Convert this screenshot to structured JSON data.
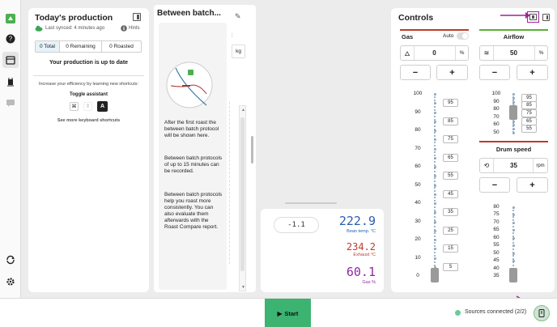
{
  "production": {
    "title": "Today's production",
    "last_synced": "Last synced: 4 minutes ago",
    "hints": "Hints",
    "tabs": [
      "0 Total",
      "0 Remaining",
      "0 Roasted"
    ],
    "status": "Your production is up to date",
    "efficiency_text": "Increase your efficiency by learning new shortcuts:",
    "toggle_label": "Toggle assistant",
    "keys": [
      "⌘",
      "⇧",
      "A"
    ],
    "see_more": "See more keyboard shortcuts"
  },
  "between_batch": {
    "title": "Between batch...",
    "p1": "After the first roast the between batch protocol will be shown here.",
    "p2": "Between batch protocols of up to 15 minutes can be recorded.",
    "p3": "Between batch protocols help you roast more consistently. You can also evaluate them afterwards with the Roast Compare report."
  },
  "unit_label": "kg",
  "readings": {
    "delta": "-1.1",
    "bean_temp": "222.9",
    "bean_label": "Bean temp. °C",
    "exhaust": "234.2",
    "exhaust_label": "Exhaust °C",
    "gas": "60.1",
    "gas_label": "Gas %",
    "bean_color": "#2a5db0",
    "exhaust_color": "#c0392b",
    "gas_color": "#8e2a9e"
  },
  "controls": {
    "title": "Controls",
    "gas": {
      "label": "Gas",
      "auto_label": "Auto",
      "value": "0",
      "unit": "%",
      "ticks_left": [
        "100",
        "90",
        "80",
        "70",
        "60",
        "50",
        "40",
        "30",
        "20",
        "10",
        "0"
      ],
      "ticks_right": [
        "95",
        "85",
        "75",
        "65",
        "55",
        "45",
        "35",
        "25",
        "15",
        "5"
      ],
      "level": 0.0,
      "color": "#c0392b"
    },
    "airflow": {
      "label": "Airflow",
      "value": "50",
      "unit": "%",
      "ticks_left": [
        "100",
        "90",
        "80",
        "70",
        "60",
        "50"
      ],
      "ticks_right": [
        "95",
        "85",
        "75",
        "65",
        "55"
      ],
      "level": 0.5,
      "color": "#5ab033"
    },
    "drum": {
      "label": "Drum speed",
      "value": "35",
      "unit": "rpm",
      "ticks_left": [
        "80",
        "75",
        "70",
        "65",
        "60",
        "55",
        "50",
        "45",
        "40",
        "35"
      ],
      "level": 0.0,
      "color": "#c0392b"
    },
    "minus": "−",
    "plus": "+"
  },
  "footer": {
    "start": "Start",
    "sources": "Sources connected (2/2)",
    "start_color": "#3cb371",
    "sources_color": "#66cc99"
  },
  "annotation_color": "#a020a0"
}
